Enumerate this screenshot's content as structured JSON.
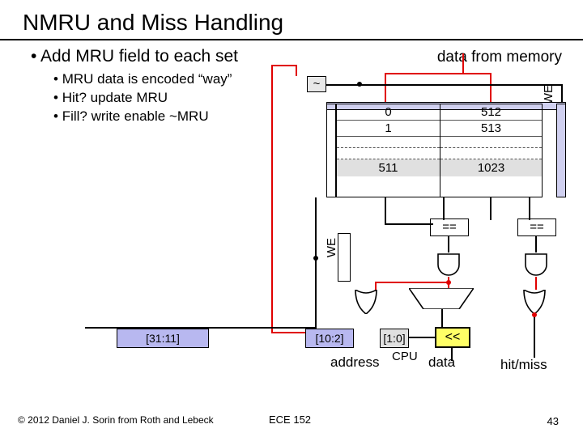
{
  "title": "NMRU and Miss Handling",
  "main_bullet": "Add MRU field to each set",
  "sub_bullets": {
    "b1": "MRU data is encoded “way”",
    "b2": "Hit? update MRU",
    "b3": "Fill? write enable ~MRU"
  },
  "labels": {
    "data_from_memory": "data from memory",
    "we_top": "WE",
    "we_mid": "WE",
    "tilde": "~",
    "eq": "==",
    "shift": "<<",
    "address": "address",
    "cpu": "CPU",
    "data": "data",
    "hitmiss": "hit/miss"
  },
  "table": {
    "colA": {
      "r0": "0",
      "r1": "1",
      "r3": "511"
    },
    "colB": {
      "r0": "512",
      "r1": "513",
      "r3": "1023"
    }
  },
  "addr_bits": {
    "hi": "[31:11]",
    "mid": "[10:2]",
    "lo": "[1:0]"
  },
  "footer": {
    "copyright": "© 2012 Daniel J. Sorin from Roth and Lebeck",
    "course": "ECE 152",
    "page": "43"
  }
}
